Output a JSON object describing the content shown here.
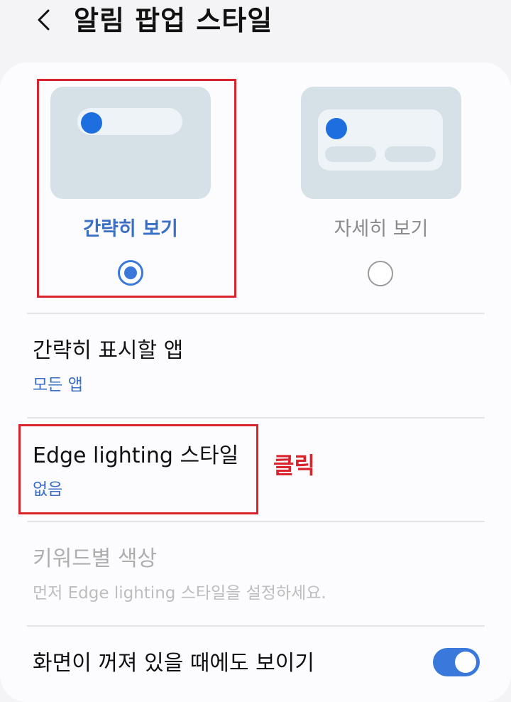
{
  "header": {
    "title": "알림 팝업 스타일",
    "back_icon": "chevron-left-icon"
  },
  "styles": [
    {
      "label": "간략히 보기",
      "selected": true
    },
    {
      "label": "자세히 보기",
      "selected": false
    }
  ],
  "settings": {
    "apps_title": "간략히 표시할 앱",
    "apps_value": "모든 앱",
    "edge_title": "Edge lighting 스타일",
    "edge_value": "없음",
    "keyword_title": "키워드별 색상",
    "keyword_hint": "먼저 Edge lighting 스타일을 설정하세요.",
    "screen_off_title": "화면이 꺼져 있을 때에도 보이기",
    "screen_off_enabled": true
  },
  "annotation": {
    "label": "클릭"
  },
  "colors": {
    "accent": "#3a79db",
    "highlight": "#d9232d",
    "preview": "#d5e1e7"
  }
}
